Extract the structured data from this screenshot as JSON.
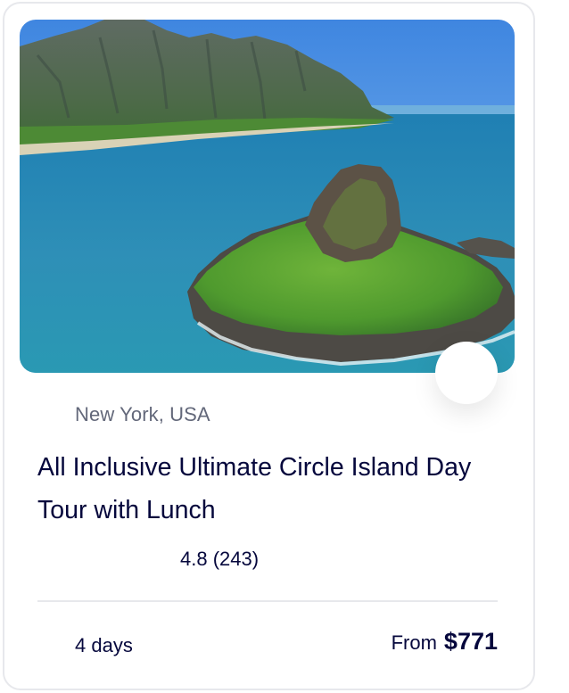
{
  "card": {
    "image_alt": "Aerial view of a small green island in turquoise sea with mountains",
    "location": "New York, USA",
    "title": "All Inclusive Ultimate Circle Island Day Tour with Lunch",
    "rating": "4.8 (243)",
    "duration": "4 days",
    "price_prefix": "From",
    "price": "$771"
  },
  "icons": {
    "favorite": "heart-icon",
    "location": "map-pin-icon",
    "rating": "star-icon",
    "duration": "clock-icon"
  },
  "colors": {
    "title": "#05073c",
    "muted": "#63687a",
    "border": "#e7e8ec",
    "star": "#f7b500"
  }
}
